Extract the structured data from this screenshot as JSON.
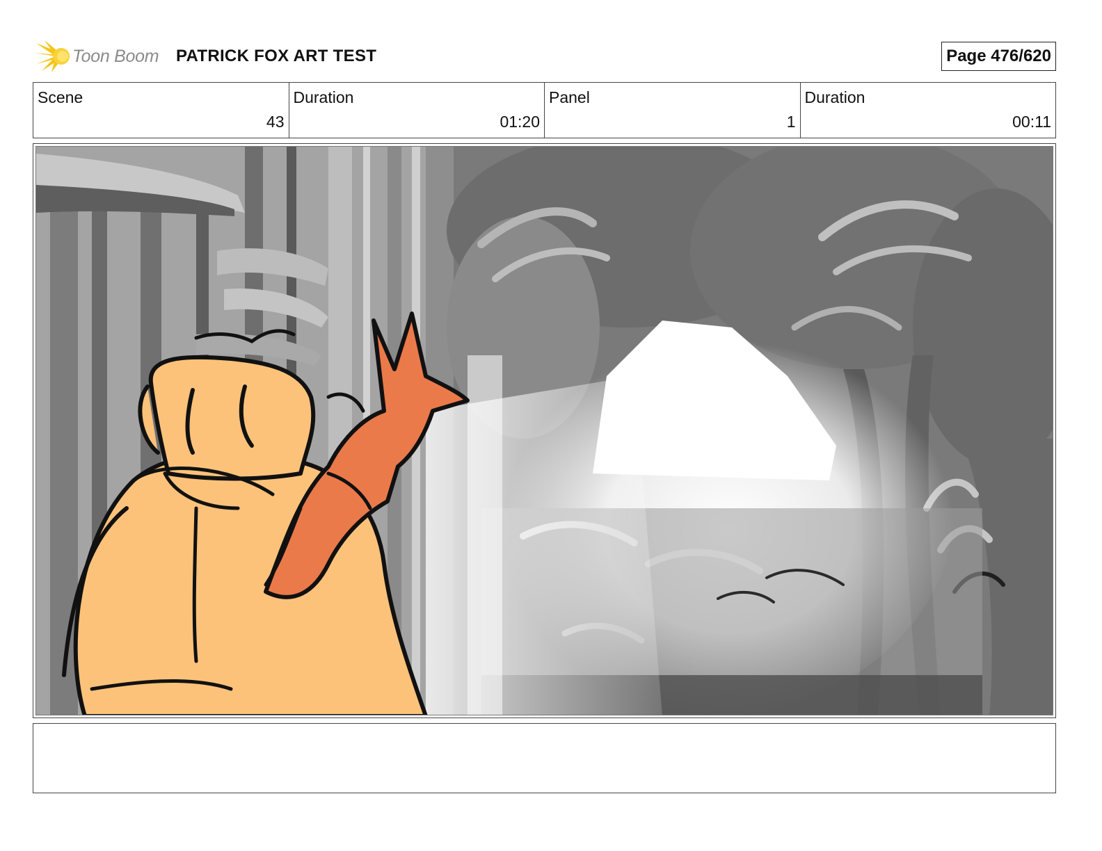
{
  "header": {
    "logo_text": "Toon Boom",
    "project_title": "PATRICK FOX ART TEST",
    "page_label": "Page 476/620"
  },
  "info": [
    {
      "label": "Scene",
      "value": "43"
    },
    {
      "label": "Duration",
      "value": "01:20"
    },
    {
      "label": "Panel",
      "value": "1"
    },
    {
      "label": "Duration",
      "value": "00:11"
    }
  ],
  "panel_image": {
    "description_icon": "storyboard-illustration",
    "colors": {
      "dog_fill": "#fcc27a",
      "fox_fill": "#eb7a4a",
      "outline": "#111111",
      "forest_dark": "#6f6f6f",
      "forest_mid": "#9a9a9a",
      "light": "#ffffff"
    }
  },
  "notes": {
    "text": ""
  }
}
